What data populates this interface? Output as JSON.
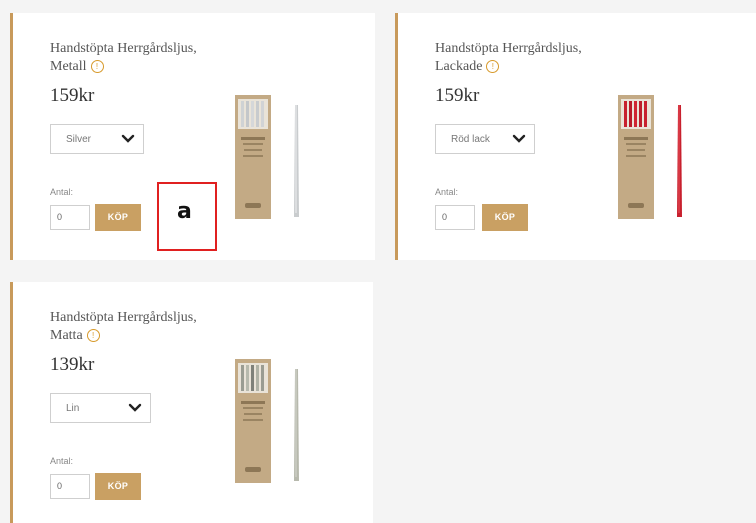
{
  "products": [
    {
      "title_line1": "Handstöpta Herrgårdsljus,",
      "title_line2": "Metall",
      "price": "159kr",
      "variant": "Silver",
      "qty_label": "Antal:",
      "qty_value": "0",
      "buy_label": "KÖP",
      "candle_color": "#c9ccce",
      "candle_highlight": "#eef0f1"
    },
    {
      "title_line1": "Handstöpta Herrgårdsljus,",
      "title_line2": "Lackade",
      "price": "159kr",
      "variant": "Röd lack",
      "qty_label": "Antal:",
      "qty_value": "0",
      "buy_label": "KÖP",
      "candle_color": "#c8202e",
      "candle_highlight": "#e8505a"
    },
    {
      "title_line1": "Handstöpta Herrgårdsljus,",
      "title_line2": "Matta",
      "price": "139kr",
      "variant": "Lin",
      "qty_label": "Antal:",
      "qty_value": "0",
      "buy_label": "KÖP",
      "candle_color": "#b7b9ad",
      "candle_highlight": "#d6d8cf"
    }
  ],
  "marker": {
    "label": "a"
  },
  "colors": {
    "accent": "#c9a063",
    "card_border": "#c89a5b",
    "info_icon": "#d79a2c",
    "marker_border": "#e02020"
  },
  "icons": {
    "info": "info-icon",
    "dropdown": "chevron-down-icon"
  }
}
